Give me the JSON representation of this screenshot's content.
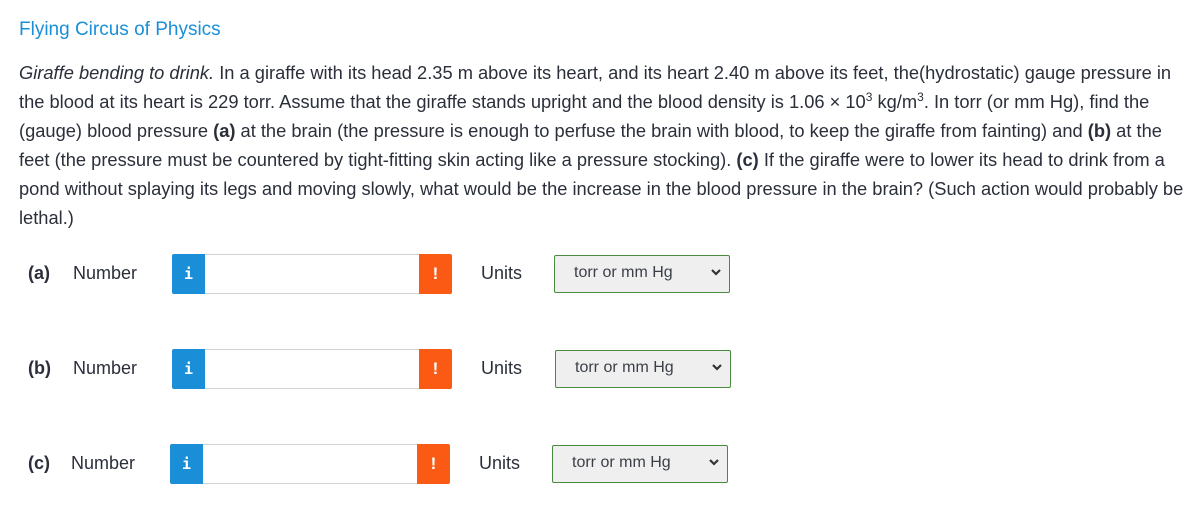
{
  "header": {
    "title": "Flying Circus of Physics"
  },
  "problem": {
    "topic": "Giraffe bending to drink.",
    "text_1": " In a giraffe with its head 2.35 m above its heart, and its heart 2.40 m above its feet, the(hydrostatic) gauge pressure in the blood at its heart is 229 torr. Assume that the giraffe stands upright and the blood density is 1.06 × 10",
    "exp_1": "3",
    "text_2": " kg/m",
    "exp_2": "3",
    "text_3": ". In torr (or mm Hg), find the (gauge) blood pressure ",
    "part_a": "(a)",
    "text_4": " at the brain (the pressure is enough to perfuse the brain with blood, to keep the giraffe from fainting) and ",
    "part_b": "(b)",
    "text_5": " at the feet (the pressure must be countered by tight-fitting skin acting like a pressure stocking). ",
    "part_c": "(c)",
    "text_6": " If the giraffe were to lower its head to drink from a pond without splaying its legs and moving slowly, what would be the increase in the blood pressure in the brain? (Such action would probably be lethal.)"
  },
  "answers": [
    {
      "part": "(a)",
      "number_label": "Number",
      "info_icon": "i",
      "value": "",
      "alert_icon": "!",
      "units_label": "Units",
      "units_selected": "torr or mm Hg"
    },
    {
      "part": "(b)",
      "number_label": "Number",
      "info_icon": "i",
      "value": "",
      "alert_icon": "!",
      "units_label": "Units",
      "units_selected": "torr or mm Hg"
    },
    {
      "part": "(c)",
      "number_label": "Number",
      "info_icon": "i",
      "value": "",
      "alert_icon": "!",
      "units_label": "Units",
      "units_selected": "torr or mm Hg"
    }
  ],
  "colors": {
    "accent": "#1a8fd8",
    "alert": "#fa5a14",
    "select_border": "#4a8a3e"
  }
}
